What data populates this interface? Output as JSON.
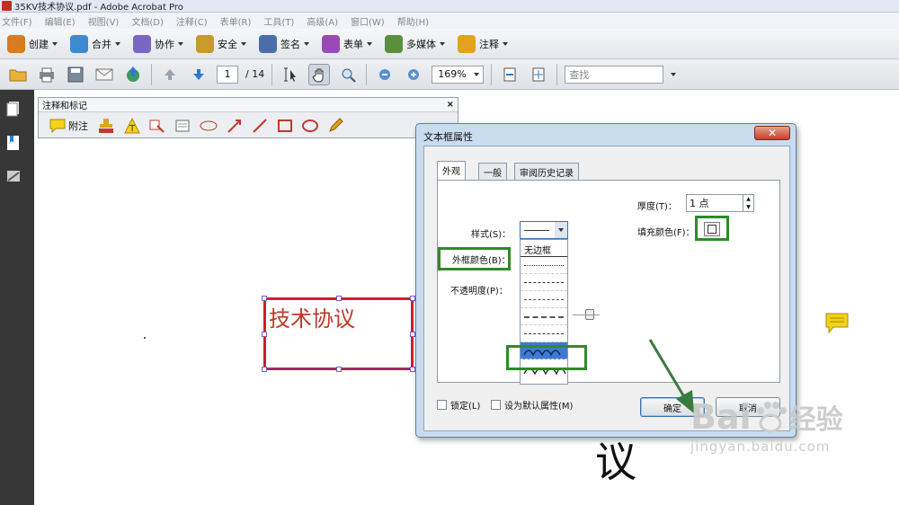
{
  "window": {
    "title": "35KV技术协议.pdf - Adobe Acrobat Pro"
  },
  "menu": [
    "文件(F)",
    "编辑(E)",
    "视图(V)",
    "文档(D)",
    "注释(C)",
    "表单(R)",
    "工具(T)",
    "高级(A)",
    "窗口(W)",
    "帮助(H)"
  ],
  "tasks": [
    {
      "label": "创建",
      "icon": "create-icon",
      "color": "#d97b1f"
    },
    {
      "label": "合并",
      "icon": "combine-icon",
      "color": "#3d8ad1"
    },
    {
      "label": "协作",
      "icon": "collaborate-icon",
      "color": "#7a67c2"
    },
    {
      "label": "安全",
      "icon": "lock-icon",
      "color": "#c79a2a"
    },
    {
      "label": "签名",
      "icon": "pen-icon",
      "color": "#4b6ea9"
    },
    {
      "label": "表单",
      "icon": "form-icon",
      "color": "#9a4ab8"
    },
    {
      "label": "多媒体",
      "icon": "multimedia-icon",
      "color": "#5b8f3c"
    },
    {
      "label": "注释",
      "icon": "comment-icon",
      "color": "#e2a21b"
    }
  ],
  "nav": {
    "page_current": "1",
    "page_total": "/ 14",
    "zoom": "169%",
    "find_placeholder": "查找"
  },
  "comment_panel": {
    "title": "注释和标记",
    "attach_label": "附注",
    "close": "×"
  },
  "annotation": {
    "text": "技术协议"
  },
  "dialog": {
    "title": "文本框属性",
    "close": "✕",
    "tabs": [
      "外观",
      "一般",
      "审阅历史记录"
    ],
    "fields": {
      "thickness_label": "厚度(T)：",
      "thickness_value": "1 点",
      "fill_color_label": "填充颜色(F)：",
      "style_label": "样式(S)：",
      "border_color_label": "外框颜色(B)：",
      "opacity_label": "不透明度(P)：",
      "no_border": "无边框"
    },
    "checkboxes": {
      "locked": "锁定(L)",
      "default": "设为默认属性(M)"
    },
    "buttons": {
      "ok": "确定",
      "cancel": "取消"
    }
  },
  "watermark": {
    "brand": "Bai",
    "brand2": "经验",
    "url": "jingyan.baidu.com"
  },
  "colors": {
    "accent": "#2f8a2a",
    "annotation_red": "#c0392b",
    "sticky_yellow": "#f3d21a"
  }
}
